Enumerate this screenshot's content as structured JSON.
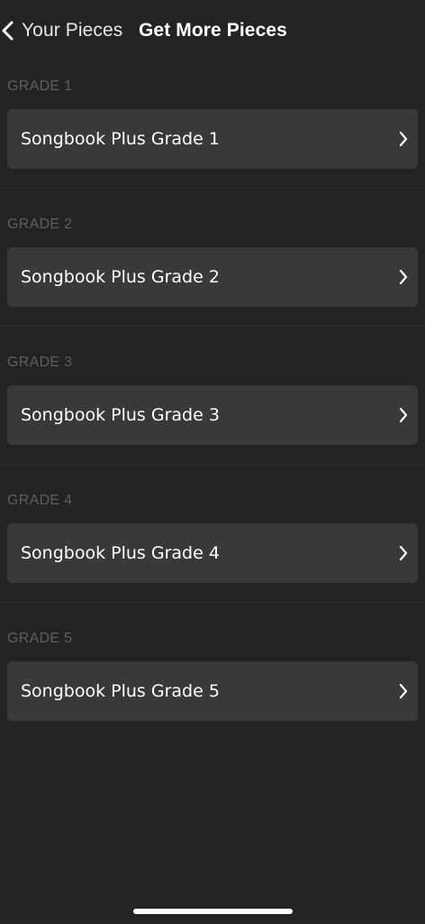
{
  "nav": {
    "back_label": "Your Pieces",
    "title": "Get More Pieces"
  },
  "sections": [
    {
      "header": "GRADE 1",
      "item_label": "Songbook Plus Grade 1"
    },
    {
      "header": "GRADE 2",
      "item_label": "Songbook Plus Grade 2"
    },
    {
      "header": "GRADE 3",
      "item_label": "Songbook Plus Grade 3"
    },
    {
      "header": "GRADE 4",
      "item_label": "Songbook Plus Grade 4"
    },
    {
      "header": "GRADE 5",
      "item_label": "Songbook Plus Grade 5"
    }
  ],
  "icons": {
    "back": "chevron-left-icon",
    "row": "chevron-right-icon"
  },
  "colors": {
    "background": "#232323",
    "row_background": "#393939",
    "section_header": "#5f5f5f",
    "text": "#ffffff"
  }
}
